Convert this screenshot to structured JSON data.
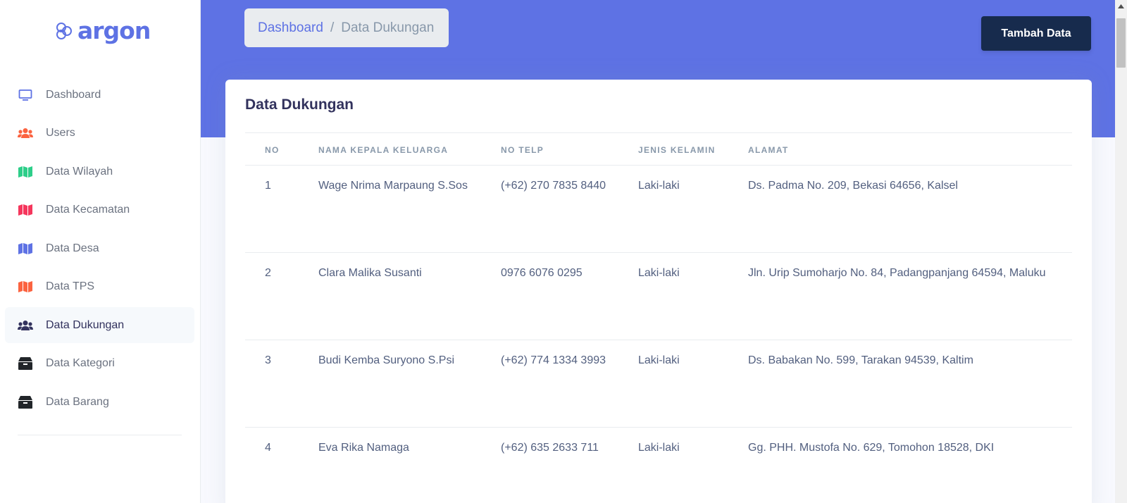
{
  "brand": {
    "name": "argon"
  },
  "sidebar": {
    "items": [
      {
        "label": "Dashboard",
        "icon": "monitor-icon",
        "color": "#5e72e4"
      },
      {
        "label": "Users",
        "icon": "users-icon",
        "color": "#fb6340"
      },
      {
        "label": "Data Wilayah",
        "icon": "map-icon",
        "color": "#2dce89"
      },
      {
        "label": "Data Kecamatan",
        "icon": "map-icon",
        "color": "#f5365c"
      },
      {
        "label": "Data Desa",
        "icon": "map-icon",
        "color": "#5e72e4"
      },
      {
        "label": "Data TPS",
        "icon": "map-icon",
        "color": "#fb6340"
      },
      {
        "label": "Data Dukungan",
        "icon": "users-icon",
        "color": "#32325d",
        "active": true
      },
      {
        "label": "Data Kategori",
        "icon": "box-icon",
        "color": "#212529"
      },
      {
        "label": "Data Barang",
        "icon": "box-icon",
        "color": "#212529"
      }
    ]
  },
  "breadcrumb": {
    "home": "Dashboard",
    "separator": "/",
    "current": "Data Dukungan"
  },
  "header": {
    "add_button": "Tambah Data"
  },
  "card": {
    "title": "Data Dukungan",
    "columns": [
      "NO",
      "NAMA KEPALA KELUARGA",
      "NO TELP",
      "JENIS KELAMIN",
      "ALAMAT"
    ],
    "rows": [
      [
        "1",
        "Wage Nrima Marpaung S.Sos",
        "(+62) 270 7835 8440",
        "Laki-laki",
        "Ds. Padma No. 209, Bekasi 64656, Kalsel"
      ],
      [
        "2",
        "Clara Malika Susanti",
        "0976 6076 0295",
        "Laki-laki",
        "Jln. Urip Sumoharjo No. 84, Padangpanjang 64594, Maluku"
      ],
      [
        "3",
        "Budi Kemba Suryono S.Psi",
        "(+62) 774 1334 3993",
        "Laki-laki",
        "Ds. Babakan No. 599, Tarakan 94539, Kaltim"
      ],
      [
        "4",
        "Eva Rika Namaga",
        "(+62) 635 2633 711",
        "Laki-laki",
        "Gg. PHH. Mustofa No. 629, Tomohon 18528, DKI"
      ]
    ]
  },
  "colors": {
    "primary": "#5e72e4",
    "dark": "#172b4d",
    "header_bg": "#5e72e4",
    "page_bg": "#f8f9fe"
  }
}
